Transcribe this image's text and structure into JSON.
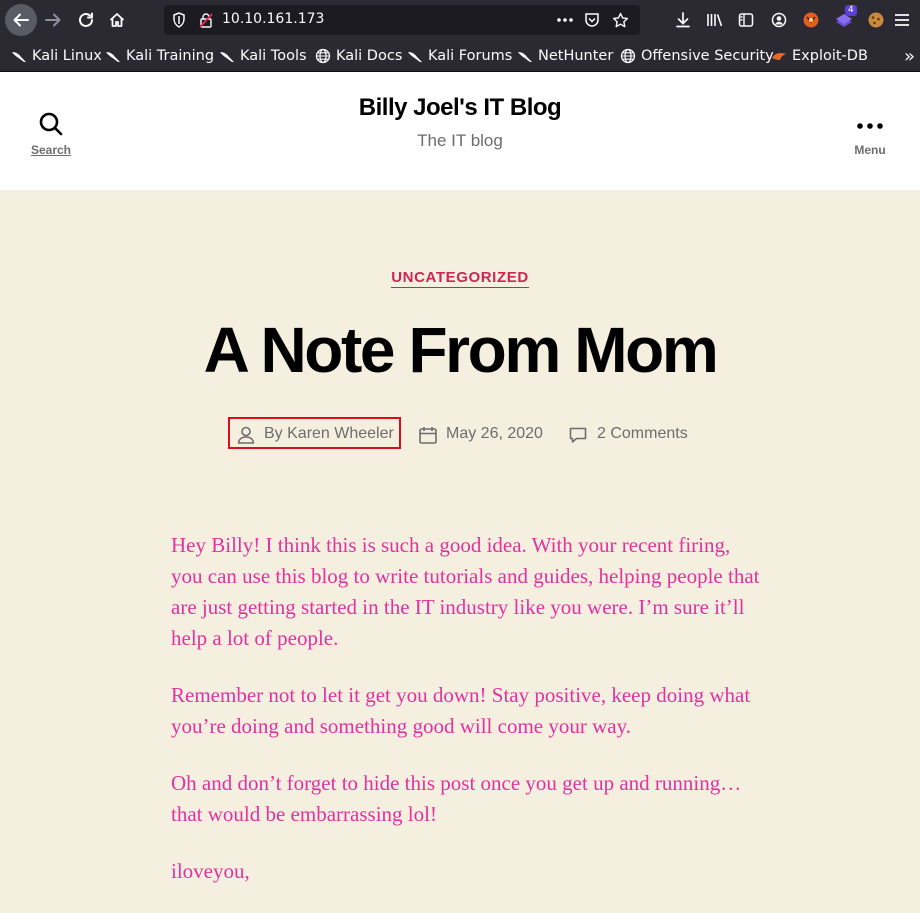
{
  "browser": {
    "url": "10.10.161.173",
    "bookmarks": [
      {
        "label": "Kali Linux",
        "icon": "kali-dragon-icon"
      },
      {
        "label": "Kali Training",
        "icon": "kali-dragon-icon"
      },
      {
        "label": "Kali Tools",
        "icon": "kali-dragon-icon"
      },
      {
        "label": "Kali Docs",
        "icon": "globe-icon"
      },
      {
        "label": "Kali Forums",
        "icon": "kali-dragon-icon"
      },
      {
        "label": "NetHunter",
        "icon": "kali-dragon-icon"
      },
      {
        "label": "Offensive Security",
        "icon": "globe-icon"
      },
      {
        "label": "Exploit-DB",
        "icon": "exploit-db-icon"
      }
    ],
    "overflow_label": "»",
    "extension_badge": "4"
  },
  "header": {
    "site_title": "Billy Joel's IT Blog",
    "site_description": "The IT blog",
    "search_label": "Search",
    "menu_label": "Menu"
  },
  "post": {
    "category": "UNCATEGORIZED",
    "title": "A Note From Mom",
    "author": "By Karen Wheeler",
    "date": "May 26, 2020",
    "comments": "2 Comments",
    "paragraphs": [
      "Hey Billy!  I think this is such a good idea.  With your recent firing, you can use this blog to write tutorials and guides, helping people that are just getting started in the IT industry like you were.  I’m sure it’ll help a lot of people.",
      "Remember not to let it get you down!  Stay positive, keep doing what you’re doing and something good will come your way.",
      "Oh and don’t forget to hide this post once you get up and running… that would be embarrassing lol!",
      "iloveyou,"
    ]
  },
  "colors": {
    "accent": "#cd2653",
    "content_text": "#e3319f",
    "background": "#f5efe0",
    "highlight_box": "#d6111a"
  }
}
